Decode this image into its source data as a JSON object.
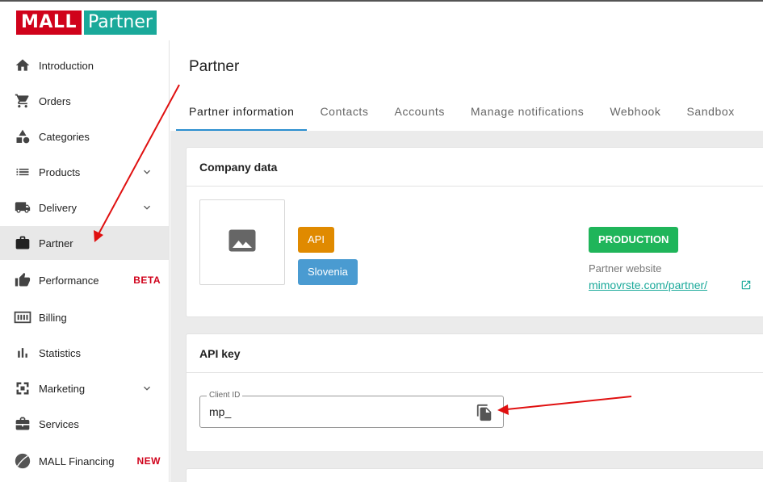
{
  "brand": {
    "mall": "MALL",
    "partner": "Partner"
  },
  "sidebar": {
    "items": [
      {
        "label": "Introduction",
        "icon": "home-icon"
      },
      {
        "label": "Orders",
        "icon": "cart-icon"
      },
      {
        "label": "Categories",
        "icon": "shapes-icon"
      },
      {
        "label": "Products",
        "icon": "list-icon",
        "expandable": true
      },
      {
        "label": "Delivery",
        "icon": "truck-icon",
        "expandable": true
      },
      {
        "label": "Partner",
        "icon": "briefcase-icon",
        "active": true
      },
      {
        "label": "Performance",
        "icon": "thumbs-up-icon",
        "badge": "BETA"
      },
      {
        "label": "Billing",
        "icon": "billing-icon"
      },
      {
        "label": "Statistics",
        "icon": "bar-chart-icon"
      },
      {
        "label": "Marketing",
        "icon": "marketing-icon",
        "expandable": true
      },
      {
        "label": "Services",
        "icon": "services-icon"
      },
      {
        "label": "MALL Financing",
        "icon": "leaf-icon",
        "badge": "NEW"
      }
    ]
  },
  "page": {
    "title": "Partner",
    "tabs": [
      "Partner information",
      "Contacts",
      "Accounts",
      "Manage notifications",
      "Webhook",
      "Sandbox"
    ],
    "active_tab": "Partner information"
  },
  "company": {
    "title": "Company data",
    "chips": {
      "api": "API",
      "region": "Slovenia",
      "environment": "PRODUCTION"
    },
    "website_label": "Partner website",
    "website_link": "mimovrste.com/partner/"
  },
  "api_key": {
    "title": "API key",
    "field_label": "Client ID",
    "field_value": "mp_"
  },
  "colors": {
    "brand_red": "#d0021b",
    "brand_teal": "#1aa99a",
    "tab_accent": "#2b8ecf",
    "chip_api": "#e08a00",
    "chip_region": "#4a9bd1",
    "chip_production": "#1fb55a",
    "annotation_arrow": "#e01010"
  }
}
